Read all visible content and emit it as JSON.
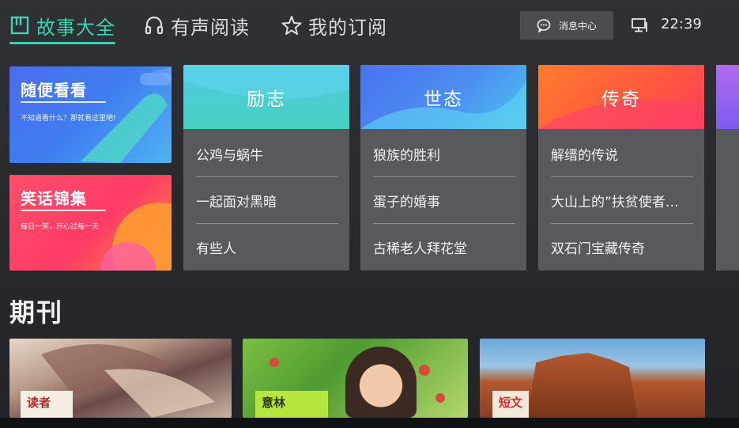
{
  "nav": {
    "tabs": [
      {
        "label": "故事大全",
        "icon": "book-icon",
        "active": true
      },
      {
        "label": "有声阅读",
        "icon": "headphones-icon",
        "active": false
      },
      {
        "label": "我的订阅",
        "icon": "star-icon",
        "active": false
      }
    ],
    "message_center": "消息中心",
    "time": "22:39"
  },
  "features": [
    {
      "title": "随便看看",
      "subtitle": "不知道看什么？那就看这里吧!"
    },
    {
      "title": "笑话锦集",
      "subtitle": "每日一笑，开心过每一天"
    }
  ],
  "categories": [
    {
      "title": "励志",
      "items": [
        "公鸡与蜗牛",
        "一起面对黑暗",
        "有些人"
      ]
    },
    {
      "title": "世态",
      "items": [
        "狼族的胜利",
        "蛋子的婚事",
        "古稀老人拜花堂"
      ]
    },
    {
      "title": "传奇",
      "items": [
        "解缙的传说",
        "大山上的”扶贫使者…",
        "双石门宝藏传奇"
      ]
    }
  ],
  "periodicals": {
    "title": "期刊",
    "items": [
      {
        "badge": "读者"
      },
      {
        "badge": "意林"
      },
      {
        "badge": "短文"
      }
    ]
  },
  "colors": {
    "accent": "#3fd1b3"
  }
}
